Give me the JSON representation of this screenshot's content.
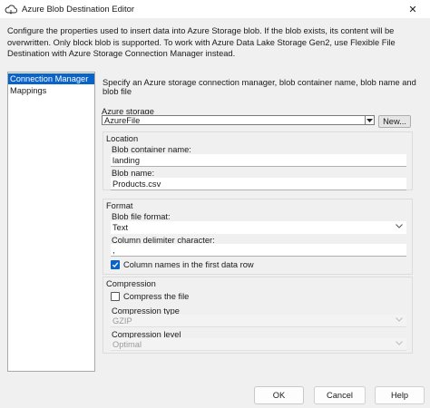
{
  "window": {
    "title": "Azure Blob Destination Editor",
    "close_glyph": "✕"
  },
  "description": "Configure the properties used to insert data into Azure Storage blob. If the blob exists, its content will be overwritten. Only block blob is supported. To work with Azure Data Lake Storage Gen2, use Flexible File Destination with Azure Storage Connection Manager instead.",
  "nav": {
    "items": [
      {
        "label": "Connection Manager",
        "selected": true
      },
      {
        "label": "Mappings",
        "selected": false
      }
    ]
  },
  "main": {
    "description": "Specify an Azure storage connection manager, blob container name, blob name and blob file",
    "azure_storage": {
      "label": "Azure storage",
      "value": "AzureFile",
      "new_button": "New..."
    },
    "location": {
      "title": "Location",
      "container_label": "Blob container name:",
      "container_value": "landing",
      "blob_label": "Blob name:",
      "blob_value": "Products.csv"
    },
    "format": {
      "title": "Format",
      "file_format_label": "Blob file format:",
      "file_format_value": "Text",
      "delimiter_label": "Column delimiter character:",
      "delimiter_value": ",",
      "column_names_label": "Column names in the first data row",
      "column_names_checked": true
    },
    "compression": {
      "title": "Compression",
      "compress_label": "Compress the file",
      "compress_checked": false,
      "type_label": "Compression type",
      "type_value": "GZIP",
      "level_label": "Compression level",
      "level_value": "Optimal"
    }
  },
  "buttons": {
    "ok": "OK",
    "cancel": "Cancel",
    "help": "Help"
  },
  "colors": {
    "accent": "#0a63c9",
    "dialog_bg": "#f0f0f0"
  }
}
